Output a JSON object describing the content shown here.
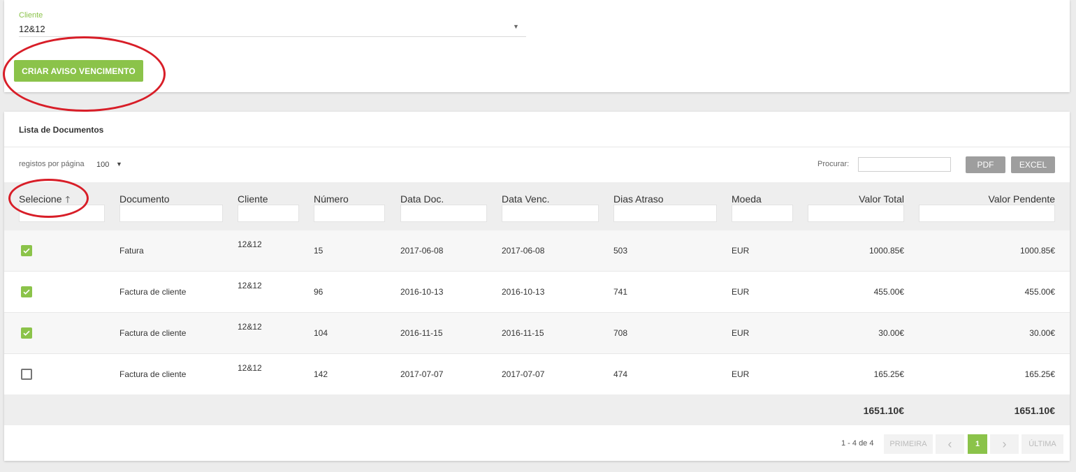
{
  "filter": {
    "client_label": "Cliente",
    "client_value": "12&12",
    "create_button": "CRIAR AVISO VENCIMENTO"
  },
  "list": {
    "title": "Lista de Documentos",
    "per_page_label": "registos por página",
    "per_page_value": "100",
    "search_label": "Procurar:",
    "pdf_button": "PDF",
    "excel_button": "EXCEL",
    "columns": [
      "Selecione",
      "Documento",
      "Cliente",
      "Número",
      "Data Doc.",
      "Data Venc.",
      "Dias Atraso",
      "Moeda",
      "Valor Total",
      "Valor Pendente"
    ],
    "rows": [
      {
        "selected": true,
        "documento": "Fatura",
        "cliente": "12&12",
        "numero": "15",
        "data_doc": "2017-06-08",
        "data_venc": "2017-06-08",
        "dias_atraso": "503",
        "moeda": "EUR",
        "valor_total": "1000.85€",
        "valor_pendente": "1000.85€"
      },
      {
        "selected": true,
        "documento": "Factura de cliente",
        "cliente": "12&12",
        "numero": "96",
        "data_doc": "2016-10-13",
        "data_venc": "2016-10-13",
        "dias_atraso": "741",
        "moeda": "EUR",
        "valor_total": "455.00€",
        "valor_pendente": "455.00€"
      },
      {
        "selected": true,
        "documento": "Factura de cliente",
        "cliente": "12&12",
        "numero": "104",
        "data_doc": "2016-11-15",
        "data_venc": "2016-11-15",
        "dias_atraso": "708",
        "moeda": "EUR",
        "valor_total": "30.00€",
        "valor_pendente": "30.00€"
      },
      {
        "selected": false,
        "documento": "Factura de cliente",
        "cliente": "12&12",
        "numero": "142",
        "data_doc": "2017-07-07",
        "data_venc": "2017-07-07",
        "dias_atraso": "474",
        "moeda": "EUR",
        "valor_total": "165.25€",
        "valor_pendente": "165.25€"
      }
    ],
    "totals": {
      "valor_total": "1651.10€",
      "valor_pendente": "1651.10€"
    }
  },
  "pagination": {
    "info": "1 - 4 de 4",
    "first": "PRIMEIRA",
    "prev": "‹",
    "current": "1",
    "next": "›",
    "last": "ÚLTIMA"
  },
  "colors": {
    "accent": "#8bc34a",
    "annotation": "#d81e28",
    "button_gray": "#9e9e9e"
  }
}
